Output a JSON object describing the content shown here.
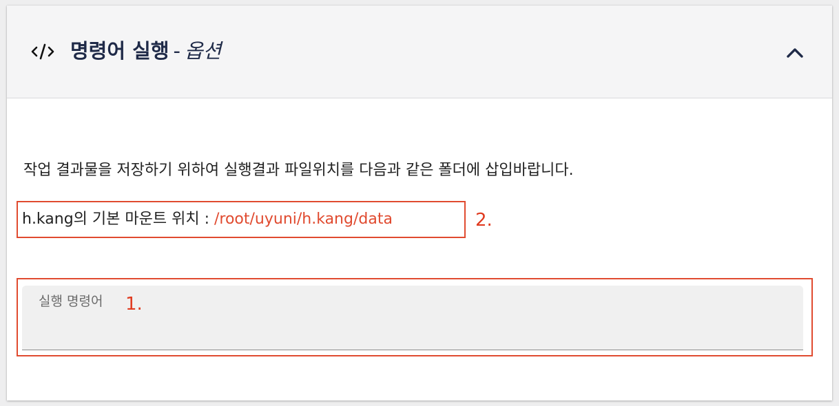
{
  "header": {
    "title": "명령어 실행",
    "separator": "-",
    "subtitle": "옵션"
  },
  "body": {
    "description": "작업 결과물을 저장하기 위하여 실행결과 파일위치를 다음과 같은 폴더에 삽입바랍니다.",
    "mount_label": "h.kang의 기본 마운트 위치 : ",
    "mount_path": "/root/uyuni/h.kang/data",
    "command_field": {
      "label": "실행 명령어",
      "value": ""
    }
  },
  "annotations": {
    "mount_marker": "2.",
    "command_marker": "1."
  },
  "colors": {
    "accent": "#e04a2f",
    "title": "#1f2a48",
    "header_bg": "#f5f5f6",
    "field_bg": "#f0f0f0"
  },
  "icons": {
    "header_icon": "code-icon",
    "collapse": "chevron-up-icon"
  }
}
